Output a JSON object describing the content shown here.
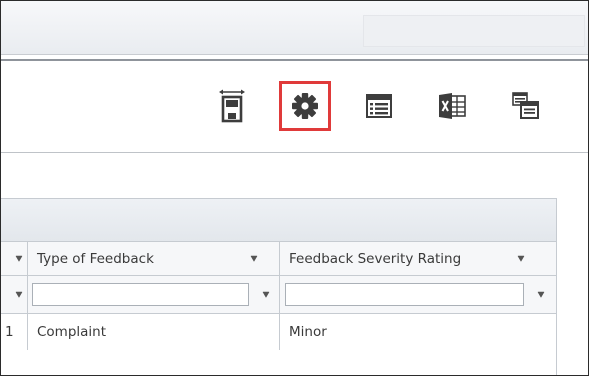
{
  "toolbar": {
    "buttons": [
      {
        "id": "save-layout",
        "icon": "save-layout-icon"
      },
      {
        "id": "settings",
        "icon": "gear-icon",
        "highlighted": true
      },
      {
        "id": "columns",
        "icon": "column-chooser-icon"
      },
      {
        "id": "excel",
        "icon": "excel-export-icon"
      },
      {
        "id": "export",
        "icon": "export-grid-icon"
      }
    ]
  },
  "grid": {
    "columns": [
      {
        "label": ""
      },
      {
        "label": "Type of Feedback"
      },
      {
        "label": "Feedback Severity Rating"
      }
    ],
    "filter": {
      "type_of_feedback": "",
      "severity_rating": ""
    },
    "rows": [
      {
        "num": "1",
        "type_of_feedback": "Complaint",
        "severity_rating": "Minor"
      }
    ]
  },
  "colors": {
    "highlight": "#e03a3a",
    "icon": "#3d3d3d",
    "grid_border": "#c6cbd1"
  }
}
